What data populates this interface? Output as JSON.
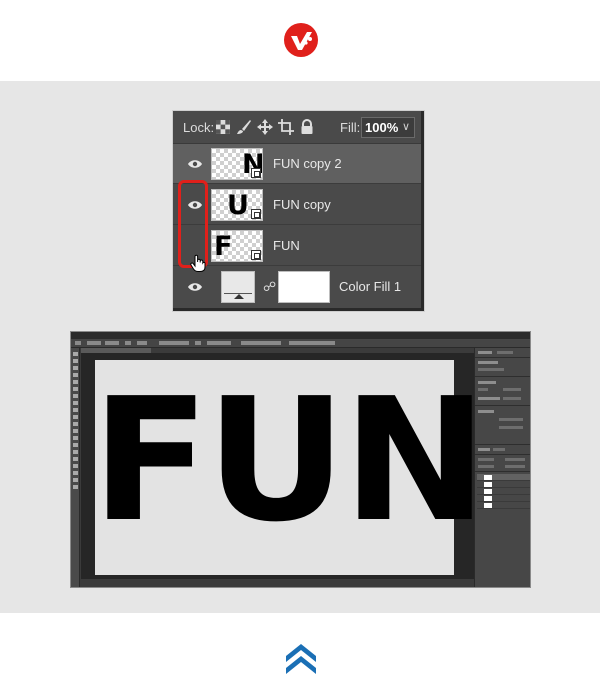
{
  "colors": {
    "brand_red": "#e0201b",
    "chevron_blue": "#1a6fb5",
    "panel_bg": "#4a4a4a",
    "band_bg": "#e6e6e6"
  },
  "icons": {
    "logo": "brand-logo-icon",
    "scroll_top": "double-chevron-up-icon"
  },
  "layers_panel": {
    "lock_label": "Lock:",
    "fill_label": "Fill:",
    "fill_value": "100%",
    "layers": [
      {
        "name": "FUN copy 2",
        "thumb_letter": "N",
        "selected": true
      },
      {
        "name": "FUN copy",
        "thumb_letter": "U",
        "selected": false
      },
      {
        "name": "FUN",
        "thumb_letter": "F",
        "selected": false
      },
      {
        "name": "Color Fill 1",
        "type": "fill"
      }
    ]
  },
  "photoshop": {
    "canvas_text": "FUN"
  }
}
